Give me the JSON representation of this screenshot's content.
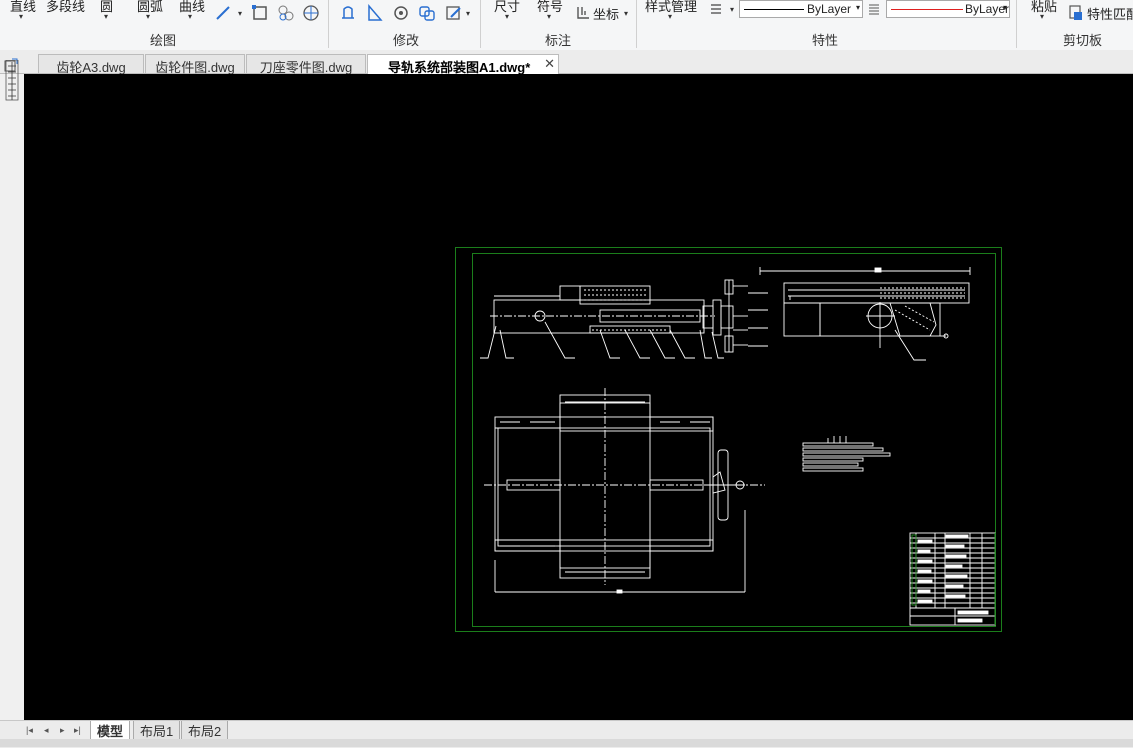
{
  "ribbon": {
    "draw": {
      "line": "直线",
      "polyline": "多段线",
      "circle": "圆",
      "arc": "圆弧",
      "curve": "曲线",
      "group_label": "绘图"
    },
    "modify": {
      "group_label": "修改"
    },
    "annotate": {
      "dimension": "尺寸",
      "symbol": "符号",
      "coordinate": "坐标",
      "group_label": "标注"
    },
    "properties": {
      "style_manager": "样式管理",
      "linetype_value": "ByLayer",
      "color_value": "ByLayer",
      "group_label": "特性"
    },
    "clipboard": {
      "paste": "粘贴",
      "match_properties": "特性匹配",
      "group_label": "剪切板"
    }
  },
  "tabs": [
    {
      "label": "齿轮A3.dwg",
      "active": false
    },
    {
      "label": "齿轮件图.dwg",
      "active": false
    },
    {
      "label": "刀座零件图.dwg",
      "active": false
    },
    {
      "label": "导轨系统部装图A1.dwg*",
      "active": true
    }
  ],
  "layout_tabs": [
    {
      "label": "模型",
      "active": true
    },
    {
      "label": "布局1",
      "active": false
    },
    {
      "label": "布局2",
      "active": false
    }
  ],
  "colors": {
    "canvas_bg": "#000000",
    "frame_green": "#1e8c1e",
    "drawing_white": "#ffffff",
    "color_combo_line": "#e02020"
  },
  "icons": [
    "line-dropdown-icon",
    "rectangle-icon",
    "hatch-icon",
    "region-icon",
    "move-icon",
    "mirror-icon",
    "rotate-icon",
    "copy-icon",
    "edit-icon",
    "coordinate-icon",
    "lineweight-icon",
    "match-properties-icon",
    "close-icon",
    "first-icon",
    "prev-icon",
    "next-icon",
    "last-icon"
  ]
}
